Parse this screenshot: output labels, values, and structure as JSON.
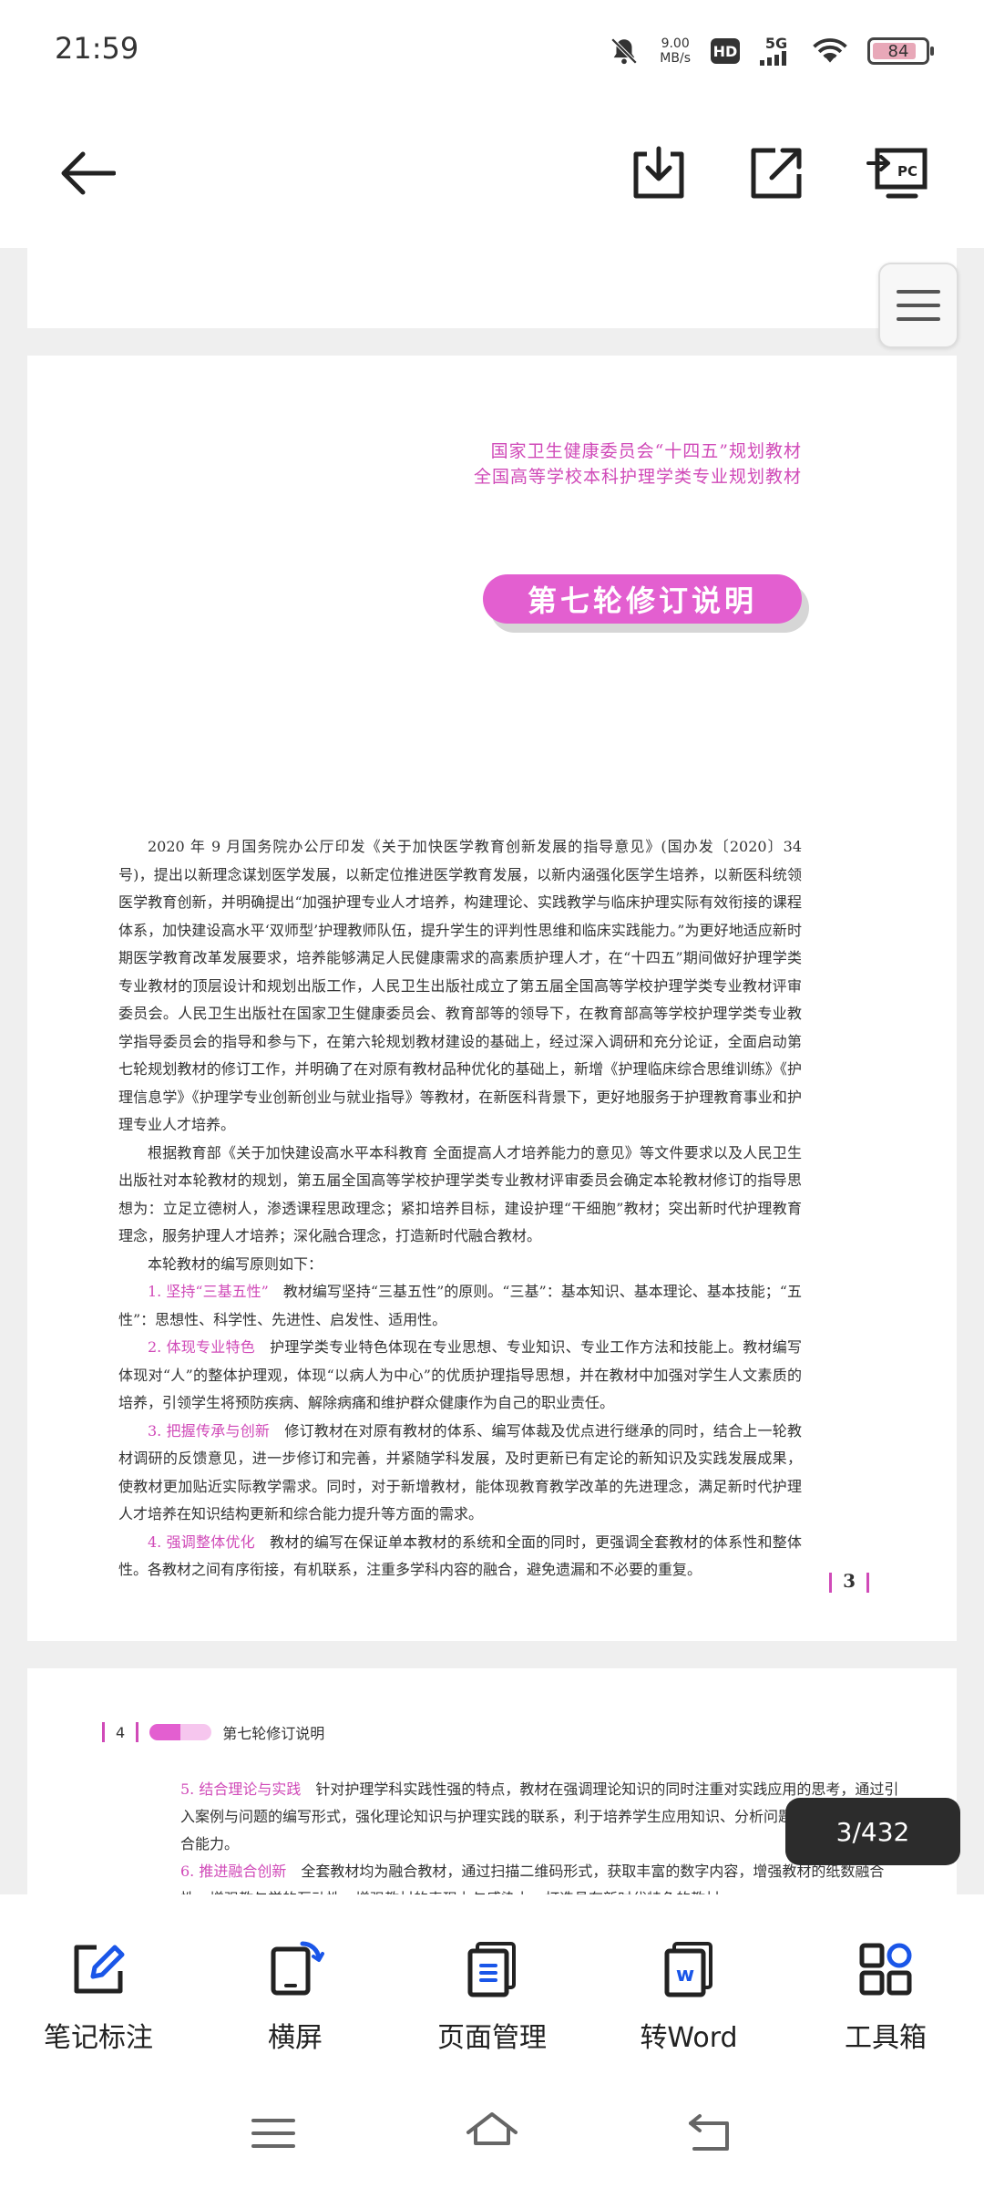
{
  "status_bar": {
    "time": "21:59",
    "speed_value": "9.00",
    "speed_unit": "MB/s",
    "hd": "HD",
    "network": "5G",
    "battery": "84",
    "battery_level": 0.84
  },
  "toolbar": {
    "back_icon": "arrow-left-icon",
    "download_icon": "download-icon",
    "share_icon": "export-icon",
    "cast_icon": "cast-to-pc-icon",
    "cast_label": "PC"
  },
  "document": {
    "header_line1": "国家卫生健康委员会“十四五”规划教材",
    "header_line2": "全国高等学校本科护理学类专业规划教材",
    "banner": "第七轮修订说明",
    "paragraphs": [
      "2020 年 9 月国务院办公厅印发《关于加快医学教育创新发展的指导意见》(国办发〔2020〕34 号)，提出以新理念谋划医学发展，以新定位推进医学教育发展，以新内涵强化医学生培养，以新医科统领医学教育创新，并明确提出“加强护理专业人才培养，构建理论、实践教学与临床护理实际有效衔接的课程体系，加快建设高水平‘双师型’护理教师队伍，提升学生的评判性思维和临床实践能力。”为更好地适应新时期医学教育改革发展要求，培养能够满足人民健康需求的高素质护理人才，在“十四五”期间做好护理学类专业教材的顶层设计和规划出版工作，人民卫生出版社成立了第五届全国高等学校护理学类专业教材评审委员会。人民卫生出版社在国家卫生健康委员会、教育部等的领导下，在教育部高等学校护理学类专业教学指导委员会的指导和参与下，在第六轮规划教材建设的基础上，经过深入调研和充分论证，全面启动第七轮规划教材的修订工作，并明确了在对原有教材品种优化的基础上，新增《护理临床综合思维训练》《护理信息学》《护理学专业创新创业与就业指导》等教材，在新医科背景下，更好地服务于护理教育事业和护理专业人才培养。",
      "根据教育部《关于加快建设高水平本科教育 全面提高人才培养能力的意见》等文件要求以及人民卫生出版社对本轮教材的规划，第五届全国高等学校护理学类专业教材评审委员会确定本轮教材修订的指导思想为：立足立德树人，渗透课程思政理念；紧扣培养目标，建设护理“干细胞”教材；突出新时代护理教育理念，服务护理人才培养；深化融合理念，打造新时代融合教材。",
      "本轮教材的编写原则如下："
    ],
    "principles": [
      {
        "title": "1. 坚持“三基五性”",
        "text": "教材编写坚持“三基五性”的原则。“三基”：基本知识、基本理论、基本技能；“五性”：思想性、科学性、先进性、启发性、适用性。"
      },
      {
        "title": "2. 体现专业特色",
        "text": "护理学类专业特色体现在专业思想、专业知识、专业工作方法和技能上。教材编写体现对“人”的整体护理观，体现“以病人为中心”的优质护理指导思想，并在教材中加强对学生人文素质的培养，引领学生将预防疾病、解除病痛和维护群众健康作为自己的职业责任。"
      },
      {
        "title": "3. 把握传承与创新",
        "text": "修订教材在对原有教材的体系、编写体裁及优点进行继承的同时，结合上一轮教材调研的反馈意见，进一步修订和完善，并紧随学科发展，及时更新已有定论的新知识及实践发展成果，使教材更加贴近实际教学需求。同时，对于新增教材，能体现教育教学改革的先进理念，满足新时代护理人才培养在知识结构更新和综合能力提升等方面的需求。"
      },
      {
        "title": "4. 强调整体优化",
        "text": "教材的编写在保证单本教材的系统和全面的同时，更强调全套教材的体系性和整体性。各教材之间有序衔接，有机联系，注重多学科内容的融合，避免遗漏和不必要的重复。"
      }
    ],
    "page_number": "3",
    "next_page_number": "4",
    "next_header_title": "第七轮修订说明",
    "next_principles": [
      {
        "title": "5. 结合理论与实践",
        "text": "针对护理学科实践性强的特点，教材在强调理论知识的同时注重对实践应用的思考，通过引入案例与问题的编写形式，强化理论知识与护理实践的联系，利于培养学生应用知识、分析问题、解决问题的综合能力。"
      },
      {
        "title": "6. 推进融合创新",
        "text": "全套教材均为融合教材，通过扫描二维码形式，获取丰富的数字内容，增强教材的纸数融合性，增强教与学的互动性，增强教材的表现力与感染力，打造具有新时代特色的教材。"
      }
    ]
  },
  "page_indicator": "3/432",
  "bottom_toolbar": [
    {
      "label": "笔记标注",
      "icon": "edit-note-icon"
    },
    {
      "label": "横屏",
      "icon": "rotate-screen-icon"
    },
    {
      "label": "页面管理",
      "icon": "page-manage-icon"
    },
    {
      "label": "转Word",
      "icon": "word-convert-icon"
    },
    {
      "label": "工具箱",
      "icon": "toolbox-icon"
    }
  ],
  "nav_bar": {
    "menu": "menu-icon",
    "home": "home-icon",
    "back": "back-icon"
  },
  "colors": {
    "accent": "#d04ab8",
    "banner": "#e35fd0",
    "indicator_bg": "#2c2c2c"
  }
}
